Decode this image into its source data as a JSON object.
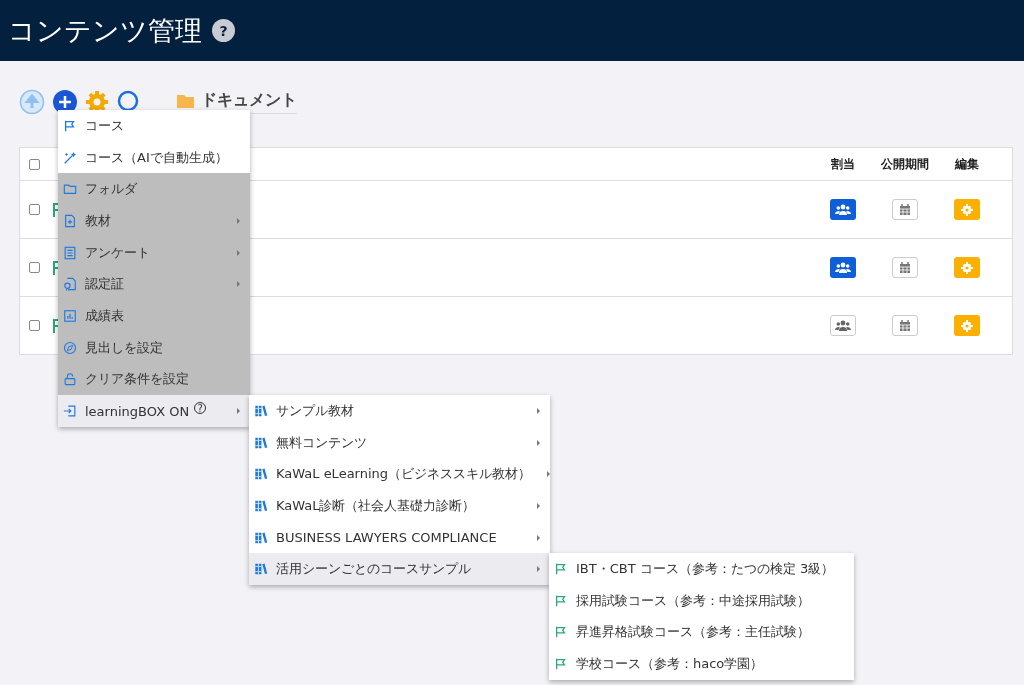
{
  "header": {
    "title": "コンテンツ管理",
    "help": "?"
  },
  "toolbar": {
    "breadcrumb": "ドキュメント"
  },
  "table": {
    "columns": [
      "割当",
      "公開期間",
      "編集"
    ],
    "header_checked": false,
    "rows": [
      {
        "checked": false,
        "assigned": true
      },
      {
        "checked": false,
        "assigned": true
      },
      {
        "checked": false,
        "assigned": false
      }
    ]
  },
  "menu": {
    "items": [
      {
        "label": "コース",
        "kind": "flag",
        "shaded": false,
        "submenu": false,
        "expanded": false
      },
      {
        "label": "コース（AIで自動生成）",
        "kind": "wand",
        "shaded": false,
        "submenu": false,
        "expanded": false
      },
      {
        "label": "フォルダ",
        "kind": "folder",
        "shaded": true,
        "submenu": false,
        "expanded": false
      },
      {
        "label": "教材",
        "kind": "file",
        "shaded": true,
        "submenu": true,
        "expanded": false
      },
      {
        "label": "アンケート",
        "kind": "list",
        "shaded": true,
        "submenu": true,
        "expanded": false
      },
      {
        "label": "認定証",
        "kind": "certificate",
        "shaded": true,
        "submenu": true,
        "expanded": false
      },
      {
        "label": "成績表",
        "kind": "chart",
        "shaded": true,
        "submenu": false,
        "expanded": false
      },
      {
        "label": "見出しを設定",
        "kind": "compass",
        "shaded": true,
        "submenu": false,
        "expanded": false
      },
      {
        "label": "クリア条件を設定",
        "kind": "lock",
        "shaded": true,
        "submenu": false,
        "expanded": false
      },
      {
        "label": "learningBOX ON",
        "kind": "import",
        "shaded": false,
        "submenu": true,
        "expanded": true,
        "help": "?"
      }
    ]
  },
  "submenu": {
    "items": [
      {
        "label": "サンプル教材",
        "kind": "books",
        "submenu": true,
        "expanded": false
      },
      {
        "label": "無料コンテンツ",
        "kind": "books",
        "submenu": true,
        "expanded": false
      },
      {
        "label": "KaWaL eLearning（ビジネススキル教材）",
        "kind": "books",
        "submenu": true,
        "expanded": false
      },
      {
        "label": "KaWaL診断（社会人基礎力診断）",
        "kind": "books",
        "submenu": true,
        "expanded": false
      },
      {
        "label": "BUSINESS LAWYERS COMPLIANCE",
        "kind": "books",
        "submenu": true,
        "expanded": false
      },
      {
        "label": "活用シーンごとのコースサンプル",
        "kind": "books",
        "submenu": true,
        "expanded": true
      }
    ]
  },
  "course_samples": {
    "items": [
      {
        "label": "IBT・CBT コース（参考：たつの検定 3級）",
        "kind": "greenflag",
        "submenu": false,
        "expanded": false
      },
      {
        "label": "採用試験コース（参考：中途採用試験）",
        "kind": "greenflag",
        "submenu": false,
        "expanded": false
      },
      {
        "label": "昇進昇格試験コース（参考：主任試験）",
        "kind": "greenflag",
        "submenu": false,
        "expanded": false
      },
      {
        "label": "学校コース（参考：haco学園）",
        "kind": "greenflag",
        "submenu": false,
        "expanded": false
      }
    ]
  }
}
